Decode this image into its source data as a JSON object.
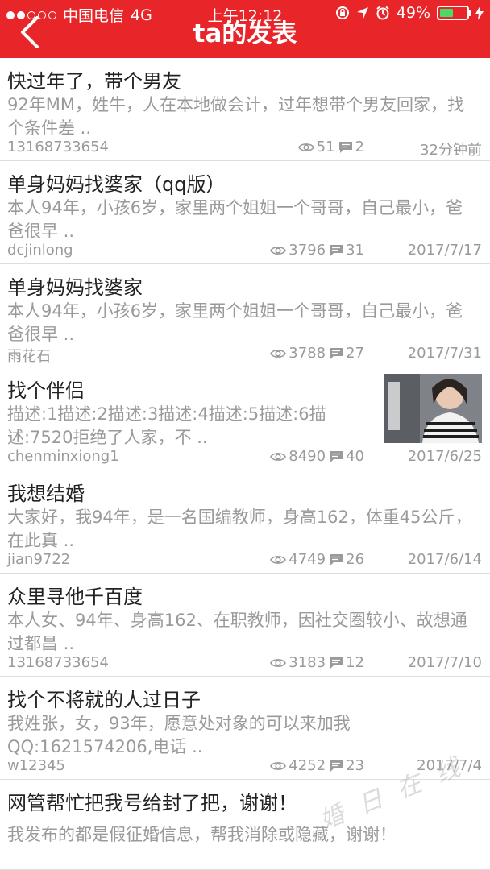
{
  "status_bar": {
    "carrier": "中国电信",
    "network": "4G",
    "time": "上午12:12",
    "battery": "49%",
    "battery_level": 0.49,
    "signal_bars_filled": 2,
    "signal_bars_total": 5,
    "colors": {
      "battery_fill": "#4cd964"
    }
  },
  "header": {
    "title": "ta的发表",
    "background_color": "#e8262a"
  },
  "posts": [
    {
      "title": "快过年了，带个男友",
      "desc": "92年MM，姓牛，人在本地做会计，过年想带个男友回家，找个条件差 ..",
      "author": "13168733654",
      "views": "51",
      "comments": "2",
      "date": "32分钟前"
    },
    {
      "title": "单身妈妈找婆家（qq版）",
      "desc": "本人94年，小孩6岁，家里两个姐姐一个哥哥，自己最小，爸爸很早 ..",
      "author": "dcjinlong",
      "views": "3796",
      "comments": "31",
      "date": "2017/7/17"
    },
    {
      "title": "单身妈妈找婆家",
      "desc": "本人94年，小孩6岁，家里两个姐姐一个哥哥，自己最小，爸爸很早 ..",
      "author": "雨花石",
      "views": "3788",
      "comments": "27",
      "date": "2017/7/31"
    },
    {
      "title": "找个伴侣",
      "desc": "描述:1描述:2描述:3描述:4描述:5描述:6描述:7520拒绝了人家，不 ..",
      "author": "chenminxiong1",
      "views": "8490",
      "comments": "40",
      "date": "2017/6/25",
      "has_thumbnail": true
    },
    {
      "title": "我想结婚",
      "desc": "大家好，我94年，是一名国编教师，身高162，体重45公斤，在此真 ..",
      "author": "jian9722",
      "views": "4749",
      "comments": "26",
      "date": "2017/6/14"
    },
    {
      "title": "众里寻他千百度",
      "desc": "本人女、94年、身高162、在职教师，因社交圈较小、故想通过都昌 ..",
      "author": "13168733654",
      "views": "3183",
      "comments": "12",
      "date": "2017/7/10"
    },
    {
      "title": "找个不将就的人过日子",
      "desc": "我姓张，女，93年，愿意处对象的可以来加我QQ:1621574206,电话 ..",
      "author": "w12345",
      "views": "4252",
      "comments": "23",
      "date": "2017/7/4"
    }
  ],
  "last_post": {
    "title": "网管帮忙把我号给封了把，谢谢！",
    "desc": "我发布的都是假征婚信息，帮我消除或隐藏，谢谢！"
  },
  "icons": {
    "back": "chevron-left-icon",
    "views": "eye-icon",
    "comments": "comment-icon"
  }
}
